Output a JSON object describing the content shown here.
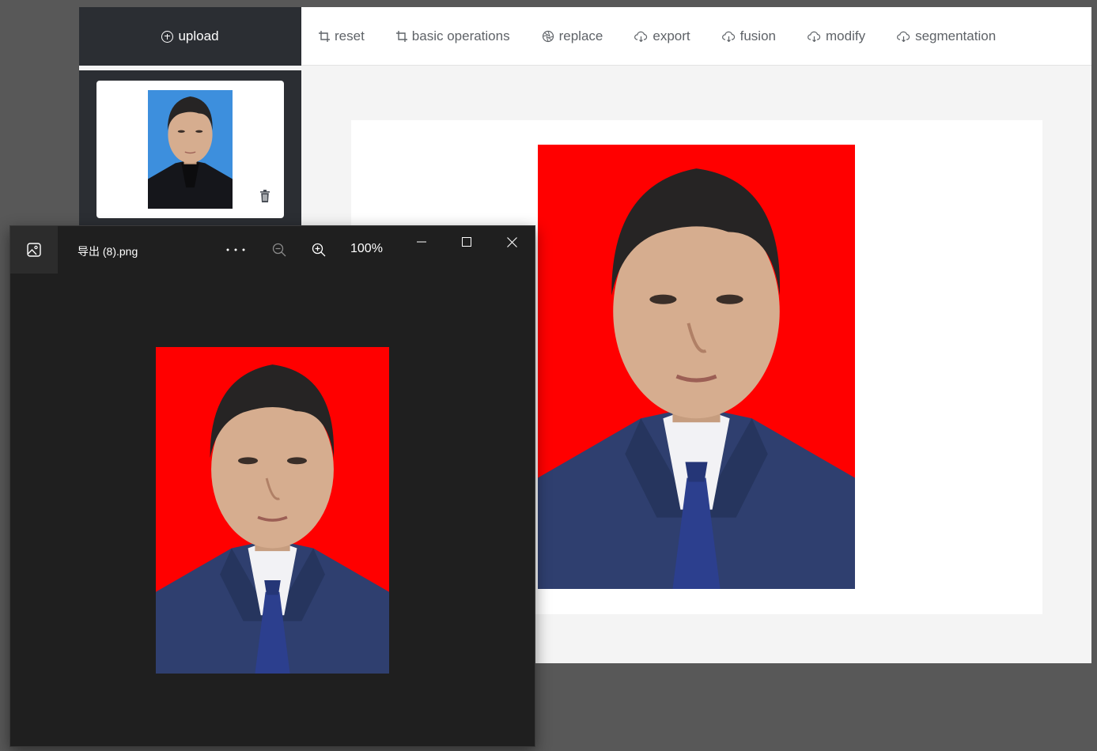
{
  "sidebar": {
    "upload_label": "upload"
  },
  "toolbar": {
    "items": [
      {
        "label": "reset",
        "icon": "crop-icon"
      },
      {
        "label": "basic operations",
        "icon": "crop-icon"
      },
      {
        "label": "replace",
        "icon": "aperture-icon"
      },
      {
        "label": "export",
        "icon": "cloud-icon"
      },
      {
        "label": "fusion",
        "icon": "cloud-icon"
      },
      {
        "label": "modify",
        "icon": "cloud-icon"
      },
      {
        "label": "segmentation",
        "icon": "cloud-icon"
      }
    ]
  },
  "viewer": {
    "title": "导出 (8).png",
    "zoom": "100%"
  },
  "colors": {
    "photo_background_red": "#ff0000",
    "thumbnail_background_blue": "#3d8fdd",
    "sidebar_dark": "#2b2e33",
    "viewer_dark": "#1f1f1f"
  }
}
